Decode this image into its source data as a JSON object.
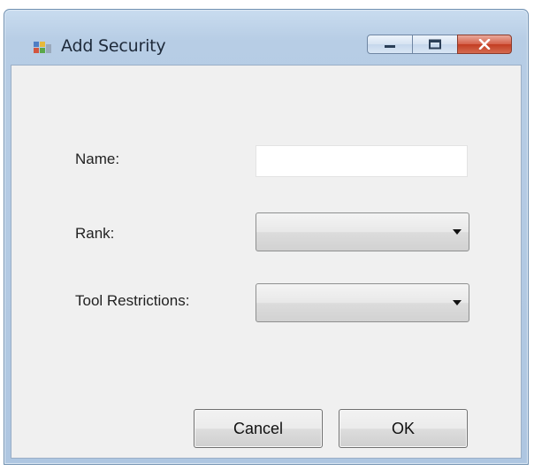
{
  "window": {
    "title": "Add Security",
    "app_icon": "app-window-icon"
  },
  "caption_buttons": {
    "minimize_icon": "minimize-icon",
    "maximize_icon": "maximize-icon",
    "close_icon": "close-icon"
  },
  "form": {
    "name_label": "Name:",
    "name_value": "",
    "rank_label": "Rank:",
    "rank_value": "",
    "tool_restrictions_label": "Tool Restrictions:",
    "tool_restrictions_value": ""
  },
  "buttons": {
    "cancel_label": "Cancel",
    "ok_label": "OK"
  },
  "colors": {
    "title_bar": "#b7cde5",
    "client_bg": "#f0f0f0",
    "close_button": "#c33d22"
  }
}
